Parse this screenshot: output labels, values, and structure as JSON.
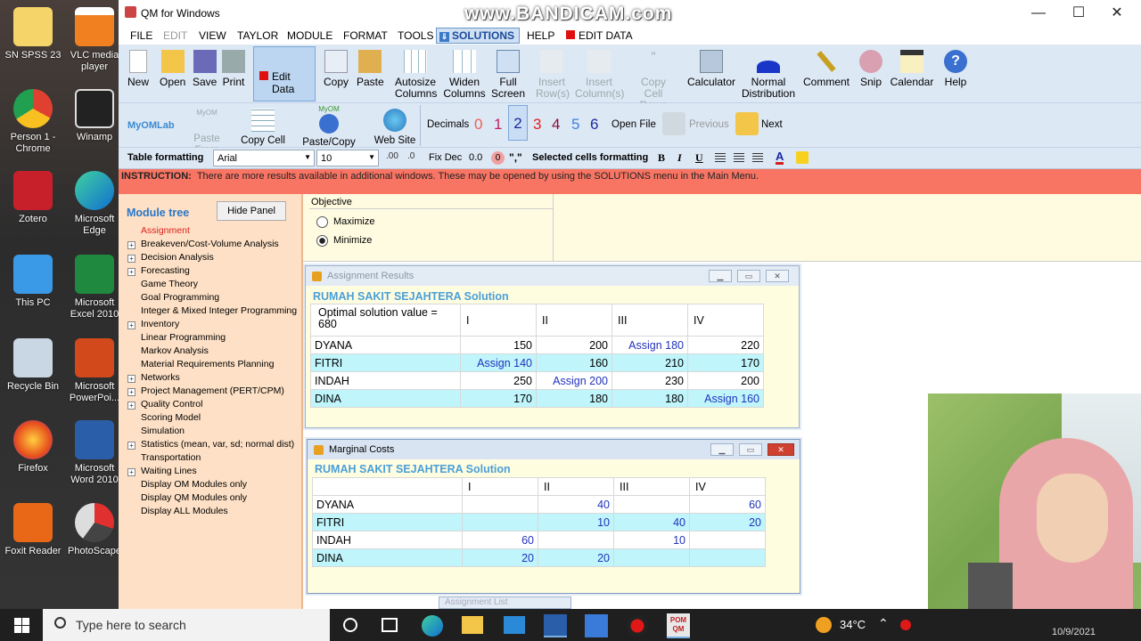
{
  "desktop": {
    "icons": [
      "SN SPSS 23",
      "VLC media player",
      "Person 1 - Chrome",
      "Winamp",
      "Zotero",
      "Microsoft Edge",
      "This PC",
      "Microsoft Excel 2010",
      "Recycle Bin",
      "Microsoft PowerPoi...",
      "Firefox",
      "Microsoft Word 2010",
      "Foxit Reader",
      "PhotoScape"
    ]
  },
  "window": {
    "title": "QM for Windows",
    "watermark": "www.BANDICAM.com",
    "minimize": "—",
    "maximize": "☐",
    "close": "✕"
  },
  "menu": [
    "FILE",
    "EDIT",
    "VIEW",
    "TAYLOR",
    "MODULE",
    "FORMAT",
    "TOOLS",
    "SOLUTIONS",
    "HELP",
    "EDIT DATA"
  ],
  "toolbar1": {
    "new": "New",
    "open": "Open",
    "save": "Save",
    "print": "Print",
    "edit_data": "Edit Data",
    "copy": "Copy",
    "paste": "Paste",
    "autosize_1": "Autosize",
    "autosize_2": "Columns",
    "widen_1": "Widen",
    "widen_2": "Columns",
    "full_1": "Full",
    "full_2": "Screen",
    "insert_row_1": "Insert",
    "insert_row_2": "Row(s)",
    "insert_col_1": "Insert",
    "insert_col_2": "Column(s)",
    "copy_cell_down_1": "Copy Cell",
    "copy_cell_down_2": "Down",
    "calculator": "Calculator",
    "normal_1": "Normal",
    "normal_2": "Distribution",
    "comment": "Comment",
    "snip": "Snip",
    "calendar": "Calendar",
    "help": "Help"
  },
  "toolbar2": {
    "myomlab": "MyOMLab",
    "myomlab_small": "MyOM",
    "paste_from": "Paste From",
    "copy_cell": "Copy Cell",
    "myom_small": "MyOM",
    "paste_copy_help": "Paste/Copy Help",
    "web_site": "Web Site",
    "decimals": "Decimals",
    "decimal_options": [
      "0",
      "1",
      "2",
      "3",
      "4",
      "5",
      "6"
    ],
    "open_file": "Open File",
    "previous": "Previous",
    "next": "Next"
  },
  "format_bar": {
    "label": "Table formatting",
    "font": "Arial",
    "size": "10",
    "fix_dec": "Fix Dec",
    "fix_value": "0.0",
    "zero": "0",
    "comma": "\",\"",
    "selected_label": "Selected cells formatting",
    "bold": "B",
    "italic": "I",
    "underline": "U"
  },
  "instruction": {
    "label": "INSTRUCTION:",
    "text": "There are more results available in additional windows. These may be opened by using the SOLUTIONS menu in the Main Menu."
  },
  "module_tree": {
    "title": "Module tree",
    "hide_button": "Hide Panel",
    "items": [
      {
        "label": "Assignment",
        "exp": false
      },
      {
        "label": "Breakeven/Cost-Volume Analysis",
        "exp": true
      },
      {
        "label": "Decision Analysis",
        "exp": true
      },
      {
        "label": "Forecasting",
        "exp": true
      },
      {
        "label": "Game Theory",
        "exp": false
      },
      {
        "label": "Goal Programming",
        "exp": false
      },
      {
        "label": "Integer & Mixed Integer Programming",
        "exp": false
      },
      {
        "label": "Inventory",
        "exp": true
      },
      {
        "label": "Linear Programming",
        "exp": false
      },
      {
        "label": "Markov Analysis",
        "exp": false
      },
      {
        "label": "Material Requirements Planning",
        "exp": false
      },
      {
        "label": "Networks",
        "exp": true
      },
      {
        "label": "Project Management (PERT/CPM)",
        "exp": true
      },
      {
        "label": "Quality Control",
        "exp": true
      },
      {
        "label": "Scoring Model",
        "exp": false
      },
      {
        "label": "Simulation",
        "exp": false
      },
      {
        "label": "Statistics (mean, var, sd; normal dist)",
        "exp": true
      },
      {
        "label": "Transportation",
        "exp": false
      },
      {
        "label": "Waiting Lines",
        "exp": true
      },
      {
        "label": "Display OM Modules only",
        "exp": false
      },
      {
        "label": "Display QM Modules only",
        "exp": false
      },
      {
        "label": "Display ALL Modules",
        "exp": false
      }
    ]
  },
  "objective": {
    "title": "Objective",
    "maximize": "Maximize",
    "minimize": "Minimize",
    "selected": "Minimize"
  },
  "results": {
    "window_title": "Assignment Results",
    "solution_title": "RUMAH SAKIT SEJAHTERA Solution",
    "header": [
      "Optimal solution value = 680",
      "I",
      "II",
      "III",
      "IV"
    ],
    "rows": [
      [
        "DYANA",
        "150",
        "200",
        "Assign 180",
        "220"
      ],
      [
        "FITRI",
        "Assign 140",
        "160",
        "210",
        "170"
      ],
      [
        "INDAH",
        "250",
        "Assign 200",
        "230",
        "200"
      ],
      [
        "DINA",
        "170",
        "180",
        "180",
        "Assign 160"
      ]
    ]
  },
  "marginal": {
    "window_title": "Marginal Costs",
    "solution_title": "RUMAH SAKIT SEJAHTERA Solution",
    "header": [
      "",
      "I",
      "II",
      "III",
      "IV"
    ],
    "rows": [
      [
        "DYANA",
        "",
        "40",
        "",
        "60"
      ],
      [
        "FITRI",
        "",
        "10",
        "40",
        "20"
      ],
      [
        "INDAH",
        "60",
        "",
        "10",
        ""
      ],
      [
        "DINA",
        "20",
        "20",
        "",
        ""
      ]
    ]
  },
  "bottom_tab": "Assignment List",
  "taskbar": {
    "search": "Type here to search",
    "temp": "34°C",
    "date": "10/9/2021"
  }
}
